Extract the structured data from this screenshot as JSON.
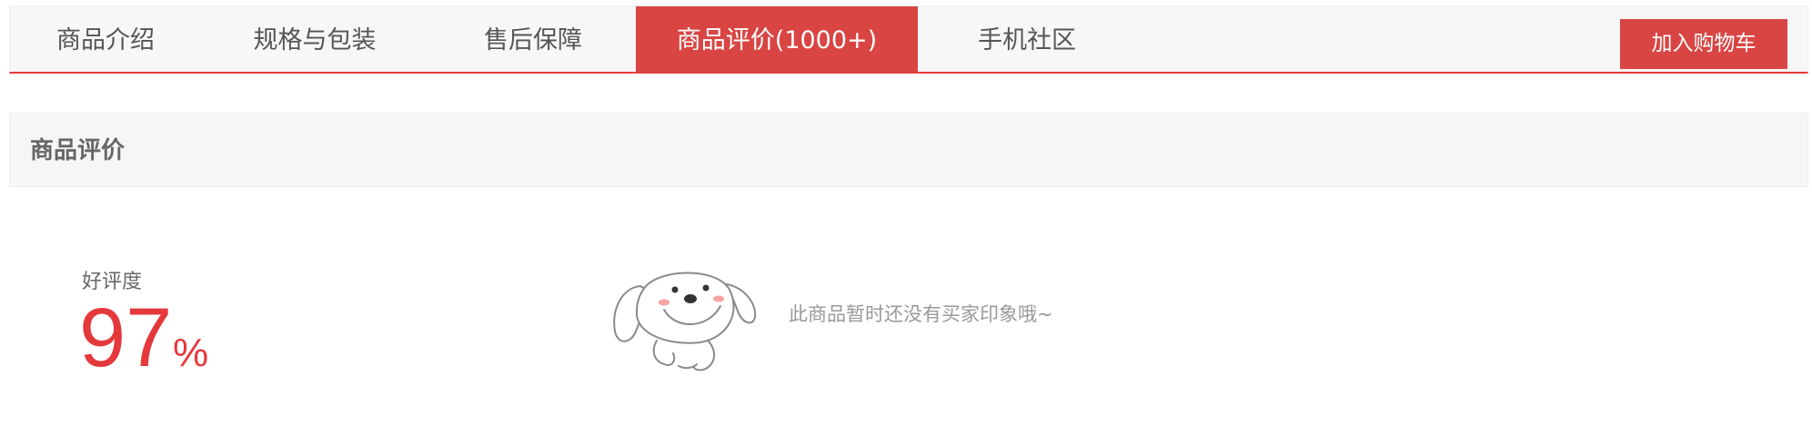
{
  "tabs": [
    {
      "label": "商品介绍"
    },
    {
      "label": "规格与包装"
    },
    {
      "label": "售后保障"
    },
    {
      "label": "商品评价(1000+)"
    },
    {
      "label": "手机社区"
    }
  ],
  "cart_button": "加入购物车",
  "section": {
    "title": "商品评价"
  },
  "rating": {
    "label": "好评度",
    "value": "97",
    "unit": "%"
  },
  "impression": {
    "empty_text": "此商品暂时还没有买家印象哦~"
  },
  "colors": {
    "accent": "#d84543",
    "rate": "#e4393c"
  },
  "icons": {
    "mascot": "jd-dog-mascot-icon"
  }
}
